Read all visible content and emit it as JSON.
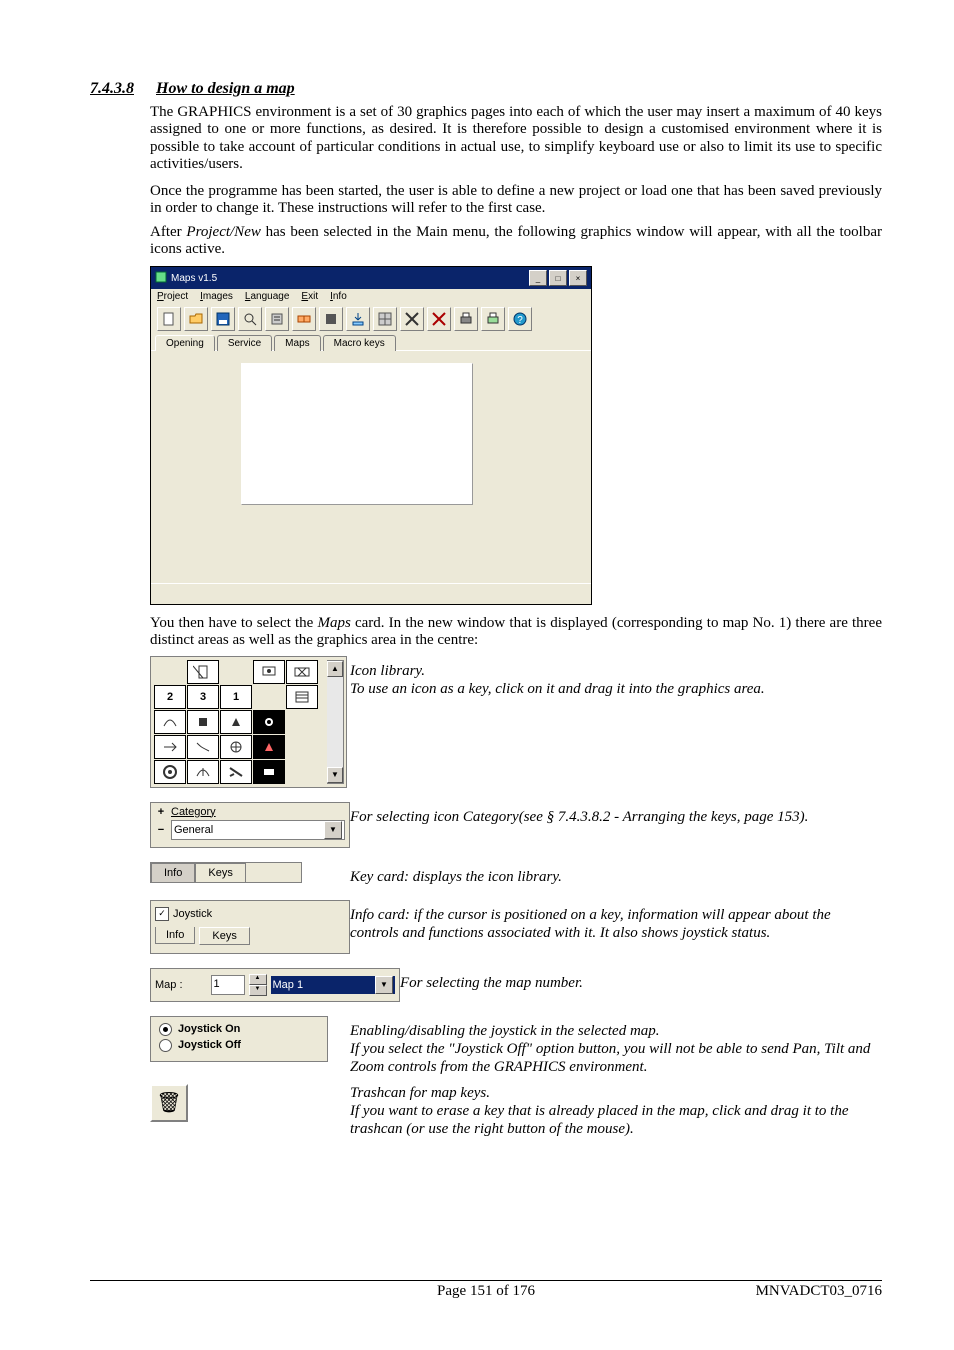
{
  "heading": {
    "num": "7.4.3.8",
    "title": "How to design a map"
  },
  "para1": "The GRAPHICS environment is a set of 30 graphics pages into each of which the user may insert a maximum of 40 keys assigned to one or more functions, as desired. It is therefore possible to design a customised environment where it is possible to take account of particular conditions in actual use, to simplify keyboard use or also to limit its use to specific activities/users.",
  "para2": "Once the programme has been started, the user is able to define a new project or load one that has been saved previously in order to change it. These instructions will refer to the first case.",
  "para3a": "After ",
  "para3b": "Project/New",
  "para3c": " has been selected in the Main menu, the following graphics window will appear, with all the toolbar icons active.",
  "app": {
    "title": "Maps v1.5",
    "menus": [
      "Project",
      "Images",
      "Language",
      "Exit",
      "Info"
    ],
    "toolbar_icons": [
      "new-file-icon",
      "open-folder-icon",
      "save-icon",
      "preview-icon",
      "settings-icon",
      "connect-icon",
      "stop-icon",
      "download-icon",
      "grid-icon",
      "settings2-icon",
      "settings3-icon",
      "print-icon",
      "print2-icon",
      "help-icon"
    ],
    "tabs": [
      "Opening",
      "Service",
      "Maps",
      "Macro keys"
    ]
  },
  "para4a": "You then have to select the ",
  "para4b": "Maps",
  "para4c": " card. In the new window that is displayed (corresponding to map No. 1) there are three distinct areas as well as the graphics area in the centre:",
  "iconlib_desc_title": "Icon library.",
  "iconlib_desc": "To use an icon as a key, click on it and drag it into the graphics area.",
  "category_label": "Category",
  "category_value": "General",
  "category_desc": "For selecting icon Category(see § 7.4.3.8.2 - Arranging the keys, page  153).",
  "keycard_tabs": {
    "info": "Info",
    "keys": "Keys"
  },
  "keycard_desc": "Key card: displays the icon library.",
  "info_check": "Joystick",
  "info_tab": "Info",
  "info_keys_btn": "Keys",
  "info_desc": "Info card: if the cursor is positioned on a key, information will appear about the controls and functions associated with it. It also shows joystick status.",
  "map_label": "Map :",
  "map_num": "1",
  "map_name": "Map 1",
  "map_desc": "For selecting the map number.",
  "joy_on": "Joystick On",
  "joy_off": "Joystick Off",
  "joy_desc1": "Enabling/disabling the joystick in the selected map.",
  "joy_desc2": "If you select the \"Joystick Off\" option button, you will not be able to send Pan, Tilt and Zoom controls from the GRAPHICS environment.",
  "trash_desc1": "Trashcan for map keys.",
  "trash_desc2": "If you want to erase a key that is already placed in the map, click and drag it to the trashcan (or use the right button of the mouse).",
  "grid_numbers": {
    "r2c1": "2",
    "r2c2": "3",
    "r2c3": "1"
  },
  "footer": {
    "center": "Page 151 of 176",
    "right": "MNVADCT03_0716"
  }
}
